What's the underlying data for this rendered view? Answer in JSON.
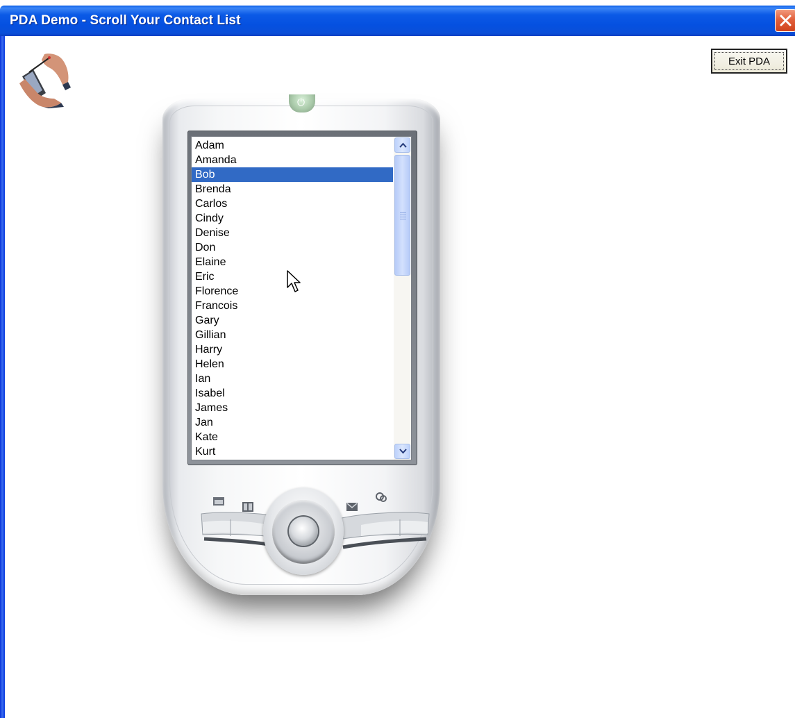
{
  "window": {
    "title": "PDA Demo - Scroll Your Contact List",
    "close_icon": "close-icon"
  },
  "toolbar": {
    "exit_label": "Exit PDA"
  },
  "contacts": {
    "items": [
      "Adam",
      "Amanda",
      "Bob",
      "Brenda",
      "Carlos",
      "Cindy",
      "Denise",
      "Don",
      "Elaine",
      "Eric",
      "Florence",
      "Francois",
      "Gary",
      "Gillian",
      "Harry",
      "Helen",
      "Ian",
      "Isabel",
      "James",
      "Jan",
      "Kate",
      "Kurt"
    ],
    "selected": "Bob"
  },
  "icons": {
    "logo": "stylus-hand-icon",
    "power": "power-icon",
    "calendar": "calendar-icon",
    "contacts": "contacts-icon",
    "inbox": "inbox-icon",
    "tasks": "tasks-icon",
    "dpad": "dpad-icon"
  },
  "colors": {
    "titlebar": "#0a5ee8",
    "selection": "#316ac5",
    "close": "#e2603c"
  }
}
